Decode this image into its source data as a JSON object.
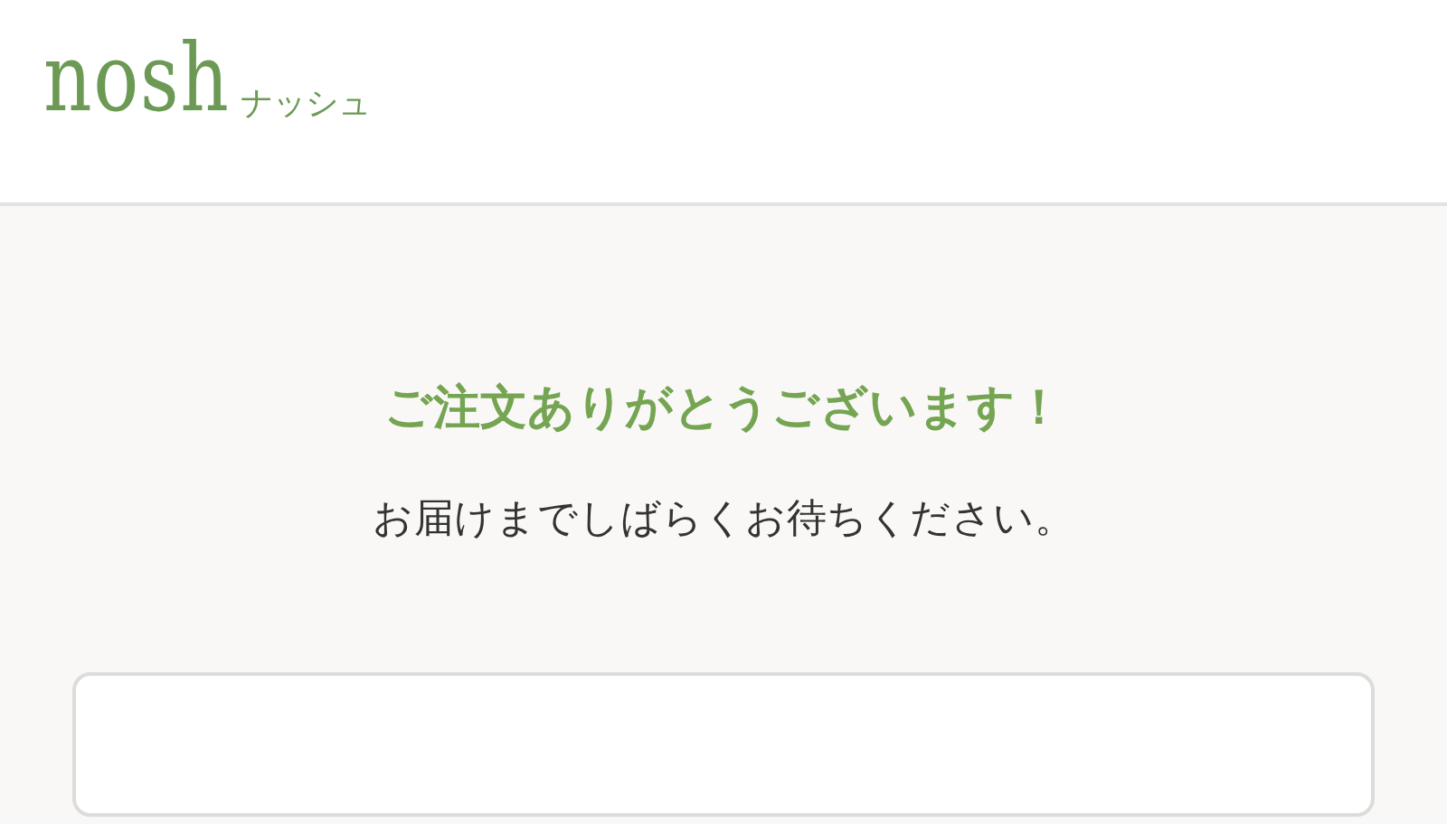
{
  "header": {
    "logo": "nosh",
    "logo_kana": "ナッシュ"
  },
  "message": {
    "title": "ご注文ありがとうございます！",
    "subtitle": "お届けまでしばらくお待ちください。"
  }
}
